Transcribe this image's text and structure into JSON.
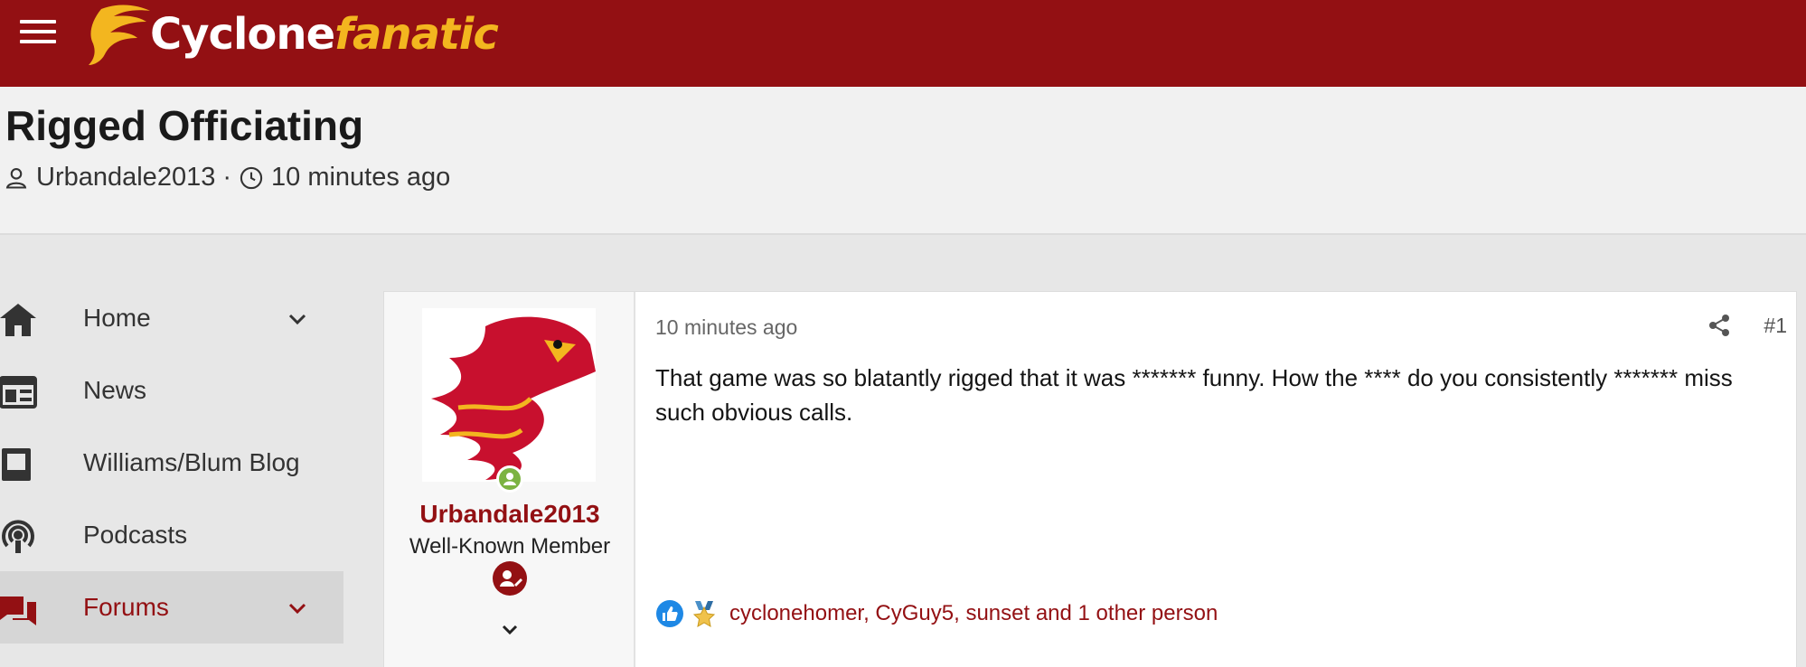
{
  "header": {
    "brand_main": "Cyclone",
    "brand_accent": "fanatic",
    "bar_color": "#931013",
    "accent_color": "#f3b61f"
  },
  "thread": {
    "title": "Rigged Officiating",
    "author": "Urbandale2013",
    "separator": "·",
    "time": "10 minutes ago"
  },
  "sidebar": {
    "items": [
      {
        "label": "Home",
        "icon": "home-icon",
        "has_chevron": true
      },
      {
        "label": "News",
        "icon": "newspaper-icon",
        "has_chevron": false
      },
      {
        "label": "Williams/Blum Blog",
        "icon": "blog-icon",
        "has_chevron": false
      },
      {
        "label": "Podcasts",
        "icon": "podcast-icon",
        "has_chevron": false
      },
      {
        "label": "Forums",
        "icon": "forums-icon",
        "has_chevron": true,
        "active": true
      }
    ]
  },
  "post": {
    "username": "Urbandale2013",
    "user_title": "Well-Known Member",
    "time": "10 minutes ago",
    "number": "#1",
    "body": "That game was so blatantly rigged that it was ******* funny. How the **** do you consistently ******* miss such obvious calls.",
    "reaction_users": "cyclonehomer, CyGuy5, sunset and 1 other person"
  }
}
